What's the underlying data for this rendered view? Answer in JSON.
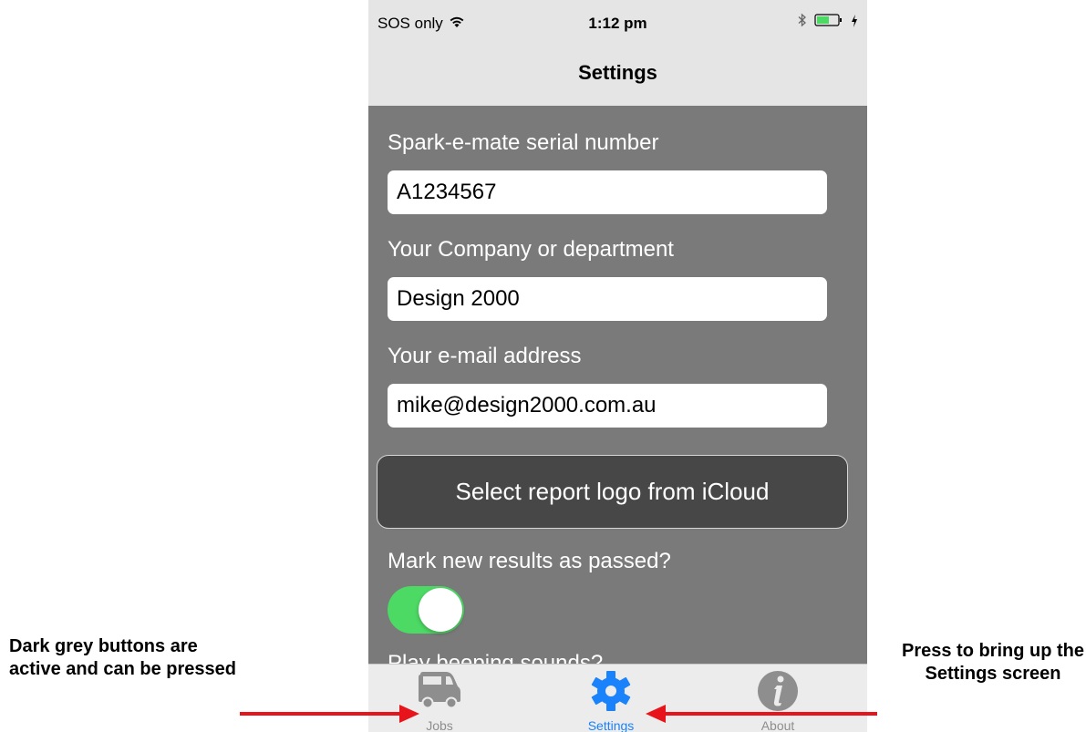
{
  "status_bar": {
    "carrier": "SOS only",
    "time": "1:12 pm",
    "icons": [
      "wifi-icon",
      "bluetooth-icon",
      "battery-icon",
      "charging-icon"
    ]
  },
  "nav": {
    "title": "Settings"
  },
  "form": {
    "serial_label": "Spark-e-mate serial number",
    "serial_value": "A1234567",
    "company_label": "Your Company or department",
    "company_value": "Design 2000",
    "email_label": "Your e-mail address",
    "email_value": "mike@design2000.com.au",
    "logo_button": "Select report logo from iCloud",
    "mark_passed_label": "Mark new results as passed?",
    "mark_passed_on": true,
    "cutoff_label": "Play beeping sounds?"
  },
  "tabs": [
    {
      "label": "Jobs",
      "icon": "van-icon",
      "active": false
    },
    {
      "label": "Settings",
      "icon": "gear-icon",
      "active": true
    },
    {
      "label": "About",
      "icon": "info-icon",
      "active": false
    }
  ],
  "annotations": {
    "left": "Dark grey buttons are active and can be pressed",
    "right": "Press to bring up the Settings screen"
  },
  "colors": {
    "content_bg": "#7a7a7a",
    "bar_bg": "#e5e5e5",
    "toggle_on": "#4cd964",
    "tab_active": "#1a82fb",
    "tab_inactive": "#8e8e8e",
    "button_bg": "#474747",
    "arrow": "#e8141b"
  }
}
